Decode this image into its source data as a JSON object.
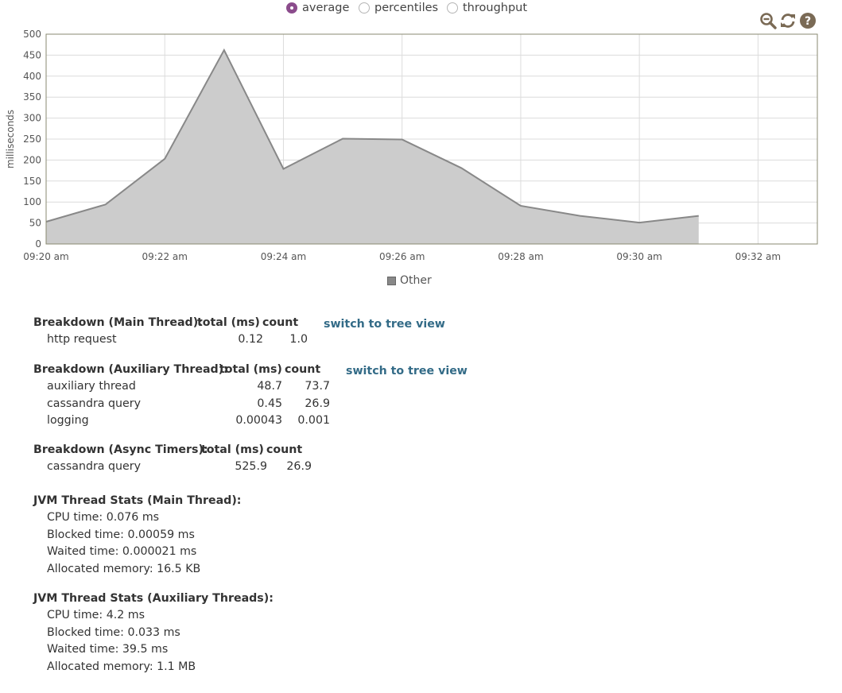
{
  "view_modes": [
    {
      "label": "average",
      "checked": true
    },
    {
      "label": "percentiles",
      "checked": false
    },
    {
      "label": "throughput",
      "checked": false
    }
  ],
  "toolbar": {
    "icons": [
      "zoom-out-icon",
      "refresh-icon",
      "help-icon"
    ],
    "icon_color": "#7a6a55"
  },
  "chart_data": {
    "type": "area",
    "ylabel": "milliseconds",
    "xlabel": "",
    "ylim": [
      0,
      500
    ],
    "yticks": [
      0,
      50,
      100,
      150,
      200,
      250,
      300,
      350,
      400,
      450,
      500
    ],
    "x_tick_labels": [
      "09:20 am",
      "09:22 am",
      "09:24 am",
      "09:26 am",
      "09:28 am",
      "09:30 am",
      "09:32 am"
    ],
    "x_tick_minutes": [
      0,
      2,
      4,
      6,
      8,
      10,
      12
    ],
    "x_range_minutes": [
      0,
      13
    ],
    "grid": true,
    "series": [
      {
        "name": "Other",
        "fill": "#cccccc",
        "stroke": "#888888",
        "x_minutes": [
          0,
          1,
          2,
          3,
          4,
          5,
          6,
          7,
          8,
          9,
          10,
          11
        ],
        "values": [
          53,
          94,
          203,
          462,
          179,
          251,
          249,
          181,
          91,
          67,
          51,
          67
        ]
      }
    ]
  },
  "legend": {
    "label": "Other"
  },
  "breakdown_main": {
    "title": "Breakdown (Main Thread):",
    "col_total": "total (ms)",
    "col_count": "count",
    "link": "switch to tree view",
    "rows": [
      {
        "name": "http request",
        "total": "0.12",
        "count": "1.0"
      }
    ]
  },
  "breakdown_aux": {
    "title": "Breakdown (Auxiliary Thread):",
    "col_total": "total (ms)",
    "col_count": "count",
    "link": "switch to tree view",
    "rows": [
      {
        "name": "auxiliary thread",
        "total": "48.7",
        "count": "73.7"
      },
      {
        "name": "cassandra query",
        "total": "0.45",
        "count": "26.9"
      },
      {
        "name": "logging",
        "total": "0.00043",
        "count": "0.001"
      }
    ]
  },
  "breakdown_async": {
    "title": "Breakdown (Async Timers):",
    "col_total": "total (ms)",
    "col_count": "count",
    "rows": [
      {
        "name": "cassandra query",
        "total": "525.9",
        "count": "26.9"
      }
    ]
  },
  "jvm_main": {
    "title": "JVM Thread Stats (Main Thread):",
    "lines": [
      "CPU time: 0.076 ms",
      "Blocked time: 0.00059 ms",
      "Waited time: 0.000021 ms",
      "Allocated memory: 16.5 KB"
    ]
  },
  "jvm_aux": {
    "title": "JVM Thread Stats (Auxiliary Threads):",
    "lines": [
      "CPU time: 4.2 ms",
      "Blocked time: 0.033 ms",
      "Waited time: 39.5 ms",
      "Allocated memory: 1.1 MB"
    ]
  }
}
